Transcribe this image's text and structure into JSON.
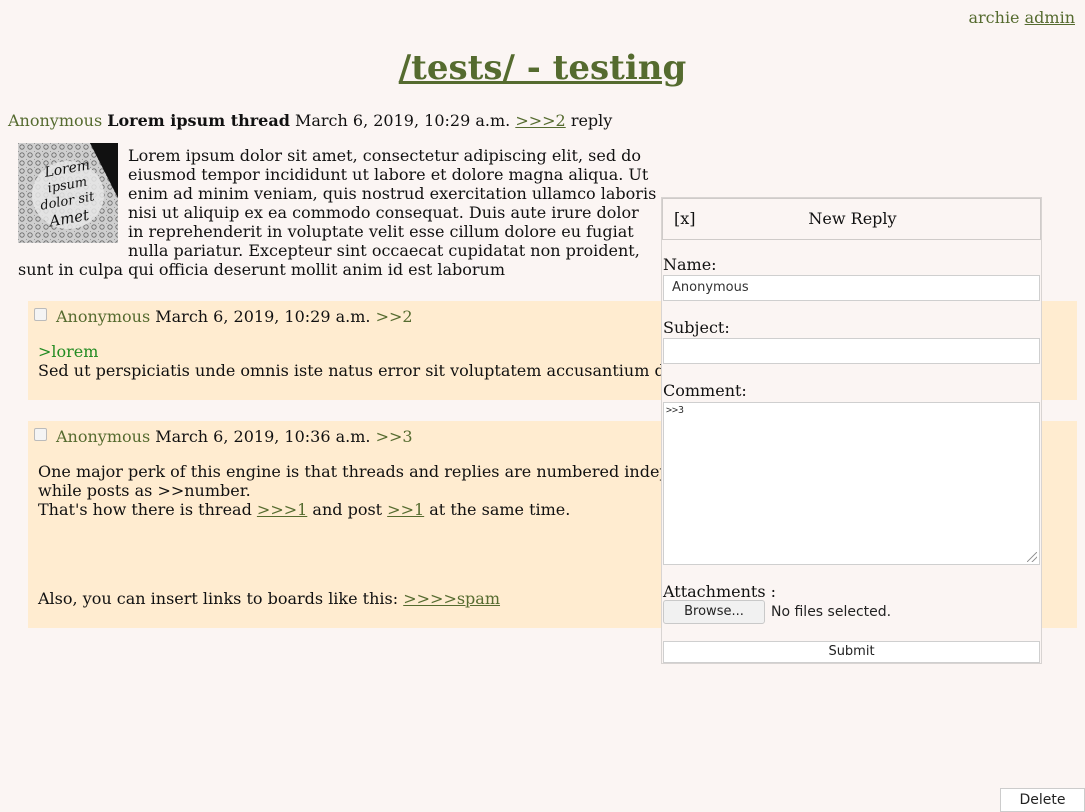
{
  "nav": {
    "user": "archie",
    "admin_link": "admin"
  },
  "board": {
    "title": "/tests/ - testing"
  },
  "op": {
    "name": "Anonymous",
    "subject": "Lorem ipsum thread",
    "date": "March 6, 2019, 10:29 a.m.",
    "thread_link": ">>>2",
    "reply_link": "reply",
    "thumbnail_text": "Lorem ipsum dolor sit Amet",
    "body": "Lorem ipsum dolor sit amet, consectetur adipiscing elit, sed do eiusmod tempor incididunt ut labore et dolore magna aliqua. Ut enim ad minim veniam, quis nostrud exercitation ullamco laboris nisi ut aliquip ex ea commodo consequat. Duis aute irure dolor in reprehenderit in voluptate velit esse cillum dolore eu fugiat nulla pariatur. Excepteur sint occaecat cupidatat non proident, sunt in culpa qui officia deserunt mollit anim id est laborum"
  },
  "replies": [
    {
      "name": "Anonymous",
      "date": "March 6, 2019, 10:29 a.m.",
      "post_link": ">>2",
      "greentext": ">lorem",
      "line1": "Sed ut perspiciatis unde omnis iste natus error sit voluptatem accusantium do"
    },
    {
      "name": "Anonymous",
      "date": "March 6, 2019, 10:36 a.m.",
      "post_link": ">>3",
      "line1": "One major perk of this engine is that threads and replies are numbered indep",
      "line2": "while posts as >>number.",
      "line3_pre": "That's how there is thread ",
      "line3_link1": ">>>1",
      "line3_mid": " and post ",
      "line3_link2": ">>1",
      "line3_post": " at the same time.",
      "line4_pre": "Also, you can insert links to boards like this: ",
      "line4_link": ">>>>spam"
    }
  ],
  "reply_form": {
    "close": "[x]",
    "title": "New Reply",
    "name_label": "Name:",
    "name_value": "Anonymous",
    "subject_label": "Subject:",
    "subject_value": "",
    "comment_label": "Comment:",
    "comment_value": ">>3",
    "attachments_label": "Attachments :",
    "browse_label": "Browse...",
    "no_files": "No files selected.",
    "submit_label": "Submit"
  },
  "delete_label": "Delete"
}
